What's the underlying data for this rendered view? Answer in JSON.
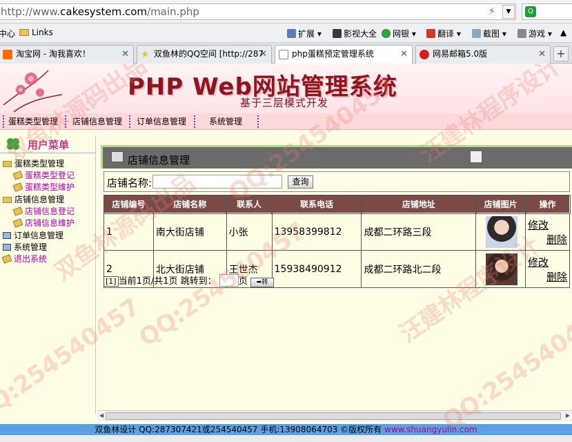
{
  "browser": {
    "url_prefix": "http://www.",
    "url_domain": "cakesystem.com",
    "url_path": "/main.php",
    "favorites": [
      {
        "label": "中心"
      },
      {
        "label": "Links"
      }
    ],
    "toolbar": [
      {
        "label": "扩展"
      },
      {
        "label": "影视大全"
      },
      {
        "label": "网银"
      },
      {
        "label": "翻译"
      },
      {
        "label": "截图"
      },
      {
        "label": "游戏"
      }
    ],
    "tabs": [
      {
        "label": "淘宝网 - 淘我喜欢！",
        "color": "#ff6a00"
      },
      {
        "label": "双鱼林的QQ空间 [http://287",
        "color": "#f4c21b"
      },
      {
        "label": "php蛋糕预定管理系统",
        "color": "#ffffff"
      },
      {
        "label": "网易邮箱5.0版",
        "color": "#d0201c"
      }
    ]
  },
  "banner": {
    "title": "PHP Web网站管理系统",
    "subtitle": "基于三层模式开发"
  },
  "topnav": [
    "蛋糕类型管理",
    "店铺信息管理",
    "订单信息管理",
    "系统管理"
  ],
  "sidebar": {
    "header": "用户菜单",
    "items": [
      {
        "label": "蛋糕类型管理"
      },
      {
        "label": "蛋糕类型登记"
      },
      {
        "label": "蛋糕类型维护"
      },
      {
        "label": "店铺信息管理"
      },
      {
        "label": "店铺信息登记"
      },
      {
        "label": "店铺信息维护"
      },
      {
        "label": "订单信息管理"
      },
      {
        "label": "系统管理"
      },
      {
        "label": "退出系统"
      }
    ]
  },
  "panel": {
    "title": "店铺信息管理",
    "search_label": "店铺名称:",
    "search_value": "",
    "query_button": "查询"
  },
  "table": {
    "headers": [
      "店铺编号",
      "店铺名称",
      "联系人",
      "联系电话",
      "店铺地址",
      "店铺图片",
      "操作"
    ],
    "rows": [
      {
        "id": "1",
        "name": "南大街店铺",
        "contact": "小张",
        "phone": "13958399812",
        "address": "成都二环路三段",
        "edit": "修改",
        "delete": "删除"
      },
      {
        "id": "2",
        "name": "北大街店铺",
        "contact": "王世杰",
        "phone": "15938490912",
        "address": "成都二环路北二段",
        "edit": "修改",
        "delete": "删除"
      }
    ]
  },
  "pager": {
    "current_page_link": "[1]",
    "text": "当前1页/共1页 跳转到：",
    "page_suffix": "页",
    "go_label": "➡转"
  },
  "footer": {
    "text": "双鱼林设计 QQ:287307421或254540457 手机:13908064703 ©版权所有",
    "link": "www.shuangyulin.com"
  },
  "watermarks": [
    "QQ:254540457",
    "双鱼林源码出品",
    "汪建林程序设计",
    "QQ:254540457",
    "双鱼林源码出品",
    "汪建林程序设计",
    "QQ:254540457",
    "QQ:254540457"
  ],
  "colors": {
    "banner_title": "#8b1520",
    "table_header_bg": "#7b4a45",
    "page_bg": "#fffde6",
    "footer_bg": "#5da0e0",
    "panel_head_bg": "#6d6a6a"
  }
}
